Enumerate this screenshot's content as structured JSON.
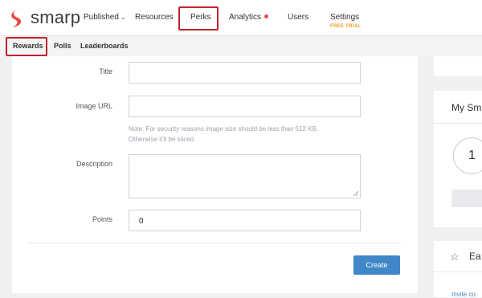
{
  "brand": {
    "name": "smarp",
    "accent": "#e8493a",
    "logo_icon": "smarp-s-icon"
  },
  "topnav": {
    "items": [
      {
        "label": "Published",
        "has_dropdown": true
      },
      {
        "label": "Resources"
      },
      {
        "label": "Perks",
        "highlighted": true
      },
      {
        "label": "Analytics",
        "has_notification_dot": true
      },
      {
        "label": "Users"
      },
      {
        "label": "Settings",
        "badge": "FREE TRIAL"
      }
    ]
  },
  "subnav": {
    "items": [
      {
        "label": "Rewards",
        "highlighted": true
      },
      {
        "label": "Polls"
      },
      {
        "label": "Leaderboards"
      }
    ]
  },
  "form": {
    "title_label": "Title",
    "title_value": "",
    "image_url_label": "Image URL",
    "image_url_value": "",
    "image_note_line1": "Note: For security reasons image size should be less than 512 KB.",
    "image_note_line2": "Otherwise it'll be sliced.",
    "description_label": "Description",
    "description_value": "",
    "points_label": "Points",
    "points_value": "0",
    "create_label": "Create"
  },
  "side_panels": {
    "panel2_title": "My Sm",
    "panel2_value": "1",
    "panel3_title": "Ea",
    "panel3_icon": "star-outline-icon",
    "panel3_link": "Invite co"
  },
  "colors": {
    "highlight_box": "#c0242f",
    "primary_button": "#3f87c7",
    "free_trial": "#f39a1e",
    "notification_dot": "#e8493a"
  }
}
